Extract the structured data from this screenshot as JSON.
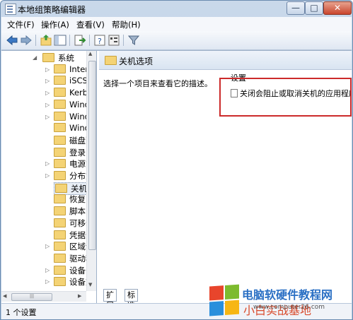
{
  "window": {
    "title": "本地组策略编辑器",
    "min": "—",
    "max": "□",
    "close": "✕"
  },
  "menu": [
    "文件(F)",
    "操作(A)",
    "查看(V)",
    "帮助(H)"
  ],
  "tree": {
    "items": [
      {
        "label": "系统",
        "expanded": true
      },
      {
        "label": "Intern"
      },
      {
        "label": "iSCSI"
      },
      {
        "label": "Kerbe"
      },
      {
        "label": "Windo"
      },
      {
        "label": "Windo"
      },
      {
        "label": "Windo"
      },
      {
        "label": "磁盘配"
      },
      {
        "label": "登录"
      },
      {
        "label": "电源管"
      },
      {
        "label": "分布式"
      },
      {
        "label": "关机选",
        "selected": true
      },
      {
        "label": "恢复"
      },
      {
        "label": "脚本"
      },
      {
        "label": "可移动"
      },
      {
        "label": "凭据分"
      },
      {
        "label": "区域设"
      },
      {
        "label": "驱动程"
      },
      {
        "label": "设备安"
      },
      {
        "label": "设备重"
      }
    ]
  },
  "right": {
    "header_title": "关机选项",
    "description": "选择一个项目来查看它的描述。",
    "column_header": "设置",
    "settings": [
      "关闭会阻止或取消关机的应用程序的自动终止功能"
    ]
  },
  "tabs": [
    "扩展",
    "标准"
  ],
  "status": "1 个设置",
  "watermark": {
    "line1": "电脑软硬件教程网",
    "line2": "小白实战基地",
    "url": "www.computer26.com"
  },
  "colors": {
    "accent": "#2a6fc4",
    "highlight": "#cc2a2a"
  }
}
